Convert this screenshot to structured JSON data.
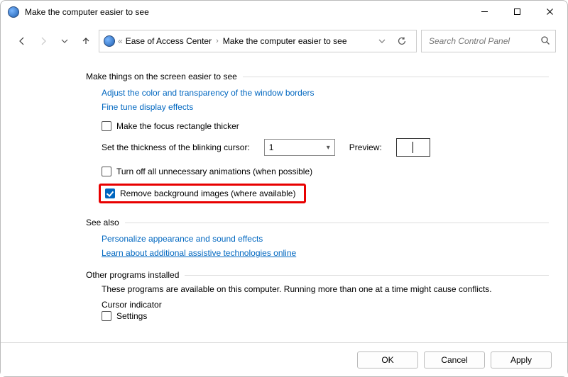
{
  "window": {
    "title": "Make the computer easier to see"
  },
  "breadcrumb": {
    "item1": "Ease of Access Center",
    "item2": "Make the computer easier to see"
  },
  "search": {
    "placeholder": "Search Control Panel"
  },
  "sections": {
    "easier": {
      "heading": "Make things on the screen easier to see",
      "link1": "Adjust the color and transparency of the window borders",
      "link2": "Fine tune display effects",
      "chk_focus": "Make the focus rectangle thicker",
      "cursor_label": "Set the thickness of the blinking cursor:",
      "cursor_value": "1",
      "preview_label": "Preview:",
      "chk_animations": "Turn off all unnecessary animations (when possible)",
      "chk_background": "Remove background images (where available)"
    },
    "seealso": {
      "heading": "See also",
      "link1": "Personalize appearance and sound effects",
      "link2": "Learn about additional assistive technologies online"
    },
    "otherprograms": {
      "heading": "Other programs installed",
      "desc": "These programs are available on this computer. Running more than one at a time might cause conflicts.",
      "sub_label": "Cursor indicator",
      "chk_settings": "Settings"
    }
  },
  "buttons": {
    "ok": "OK",
    "cancel": "Cancel",
    "apply": "Apply"
  }
}
